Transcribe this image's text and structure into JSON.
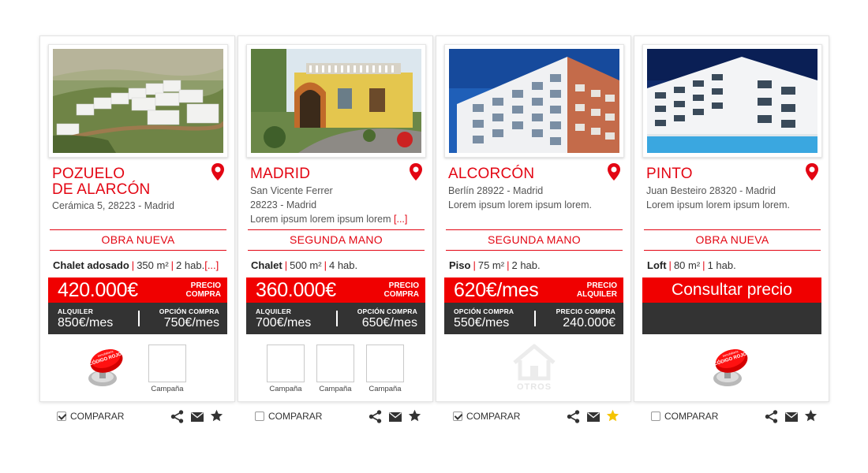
{
  "cards": [
    {
      "city": [
        "POZUELO",
        "DE ALARCÓN"
      ],
      "address_lines": [
        "Cerámica 5, 28223 - Madrid"
      ],
      "category": "OBRA NUEVA",
      "specs": {
        "type": "Chalet adosado",
        "area": "350 m²",
        "rooms": "2 hab.",
        "more": "[...]"
      },
      "price": {
        "amount": "420.000€",
        "tag": [
          "PRECIO",
          "COMPRA"
        ]
      },
      "secondary": {
        "left_label": "ALQUILER",
        "left_value": "850€/mes",
        "right_label": "OPCIÓN COMPRA",
        "right_value": "750€/mes"
      },
      "badge": {
        "text": "CÓDIGO ROJO",
        "top": "Inmobiliaria"
      },
      "campaigns": [
        "Campaña"
      ],
      "compare": {
        "label": "COMPARAR",
        "checked": true
      },
      "favorite": false
    },
    {
      "city": [
        "MADRID"
      ],
      "address_lines": [
        "San Vicente Ferrer",
        "28223 - Madrid",
        "Lorem ipsum lorem ipsum lorem"
      ],
      "address_more": "[...]",
      "category": "SEGUNDA MANO",
      "specs": {
        "type": "Chalet",
        "area": "500 m²",
        "rooms": "4 hab."
      },
      "price": {
        "amount": "360.000€",
        "tag": [
          "PRECIO",
          "COMPRA"
        ]
      },
      "secondary": {
        "left_label": "ALQUILER",
        "left_value": "700€/mes",
        "right_label": "OPCIÓN COMPRA",
        "right_value": "650€/mes"
      },
      "campaigns": [
        "Campaña",
        "Campaña",
        "Campaña"
      ],
      "compare": {
        "label": "COMPARAR",
        "checked": false
      },
      "favorite": false
    },
    {
      "city": [
        "ALCORCÓN"
      ],
      "address_lines": [
        "Berlín 28922 - Madrid",
        "Lorem ipsum lorem ipsum lorem."
      ],
      "category": "SEGUNDA MANO",
      "specs": {
        "type": "Piso",
        "area": "75 m²",
        "rooms": "2 hab."
      },
      "price": {
        "amount": "620€/mes",
        "tag": [
          "PRECIO",
          "ALQUILER"
        ]
      },
      "secondary": {
        "left_label": "OPCIÓN COMPRA",
        "left_value": "550€/mes",
        "right_label": "PRECIO COMPRA",
        "right_value": "240.000€"
      },
      "others_logo": "OTROS",
      "compare": {
        "label": "COMPARAR",
        "checked": true
      },
      "favorite": true
    },
    {
      "city": [
        "PINTO"
      ],
      "address_lines": [
        "Juan Besteiro 28320 - Madrid",
        "Lorem ipsum lorem ipsum lorem."
      ],
      "category": "OBRA NUEVA",
      "specs": {
        "type": "Loft",
        "area": "80 m²",
        "rooms": "1 hab."
      },
      "consult": "Consultar precio",
      "badge": {
        "text": "CÓDIGO ROJO",
        "top": "Inmobiliaria"
      },
      "compare": {
        "label": "COMPARAR",
        "checked": false
      },
      "favorite": false
    }
  ],
  "colors": {
    "accent": "#e30613",
    "price_red": "#f00000",
    "dark": "#333333",
    "star_active": "#f5c400",
    "icon": "#333333"
  },
  "icons": [
    "map-pin-icon",
    "share-icon",
    "mail-icon",
    "star-icon",
    "house-icon"
  ]
}
